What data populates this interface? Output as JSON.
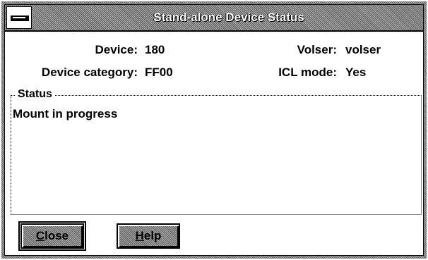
{
  "window": {
    "title": "Stand-alone Device Status"
  },
  "fields": {
    "device_label": "Device:",
    "device_value": "180",
    "volser_label": "Volser:",
    "volser_value": "volser",
    "category_label": "Device category:",
    "category_value": "FF00",
    "icl_label": "ICL mode:",
    "icl_value": "Yes"
  },
  "status_group": {
    "title": "Status",
    "text": "Mount in progress"
  },
  "buttons": {
    "close_mnemonic": "C",
    "close_rest": "lose",
    "help_mnemonic": "H",
    "help_rest": "elp"
  }
}
